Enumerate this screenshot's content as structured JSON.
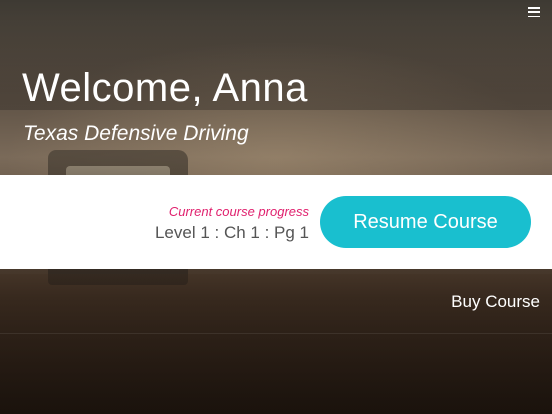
{
  "header": {
    "welcome_text": "Welcome, Anna",
    "course_name": "Texas Defensive Driving",
    "menu_icon": "hamburger-menu-icon"
  },
  "progress": {
    "label": "Current course progress",
    "value": "Level 1 : Ch 1 : Pg 1",
    "resume_label": "Resume Course"
  },
  "actions": {
    "buy_course_label": "Buy Course"
  },
  "colors": {
    "accent": "#19bfcf",
    "progress_label": "#e0216e",
    "band_background": "#ffffff"
  }
}
